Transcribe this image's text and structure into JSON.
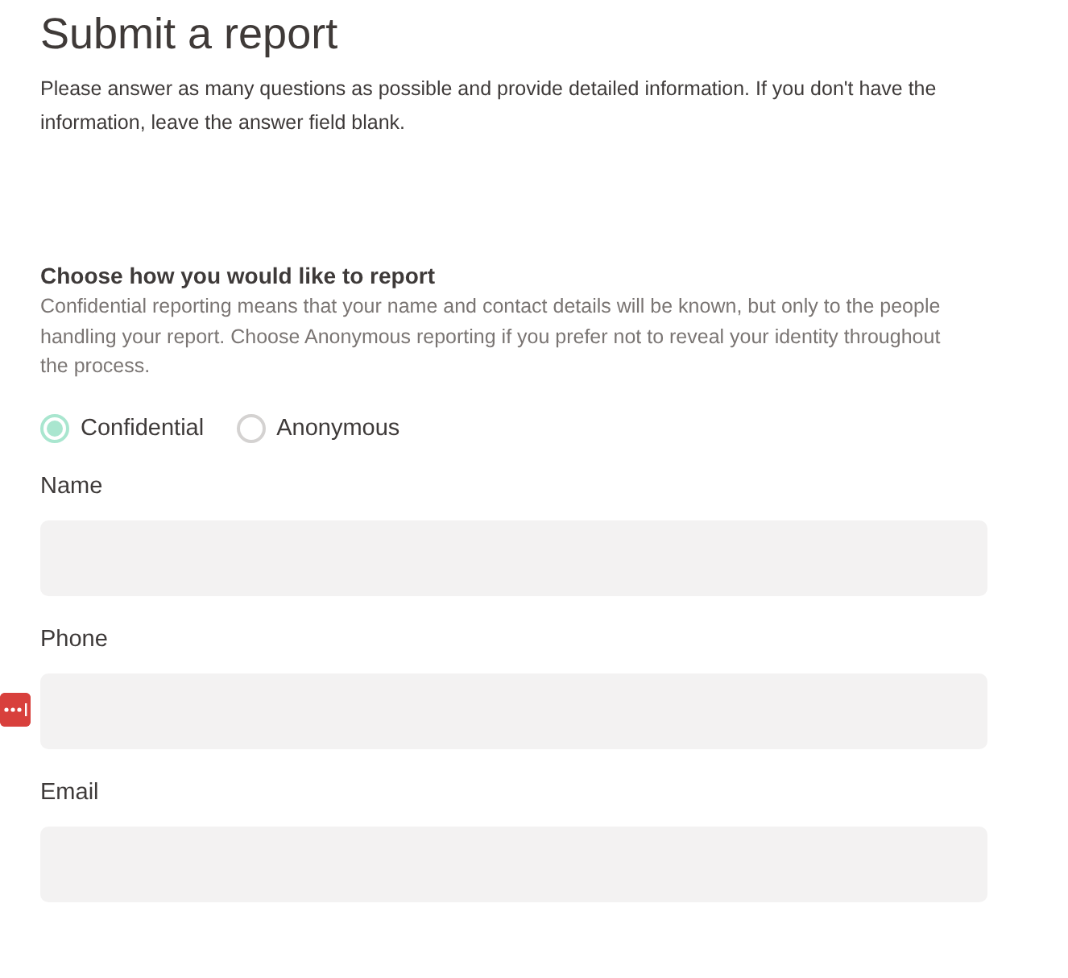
{
  "title": "Submit a report",
  "intro": "Please answer as many questions as possible and provide detailed information. If you don't have the information, leave the answer field blank.",
  "reporting": {
    "heading": "Choose how you would like to report",
    "description": "Confidential reporting means that your name and contact details will be known, but only to the people handling your report. Choose Anonymous reporting if you prefer not to reveal your identity throughout the process.",
    "options": [
      {
        "label": "Confidential",
        "selected": true
      },
      {
        "label": "Anonymous",
        "selected": false
      }
    ]
  },
  "fields": [
    {
      "label": "Name",
      "autofill_badge": false
    },
    {
      "label": "Phone",
      "autofill_badge": true
    },
    {
      "label": "Email",
      "autofill_badge": false
    }
  ]
}
